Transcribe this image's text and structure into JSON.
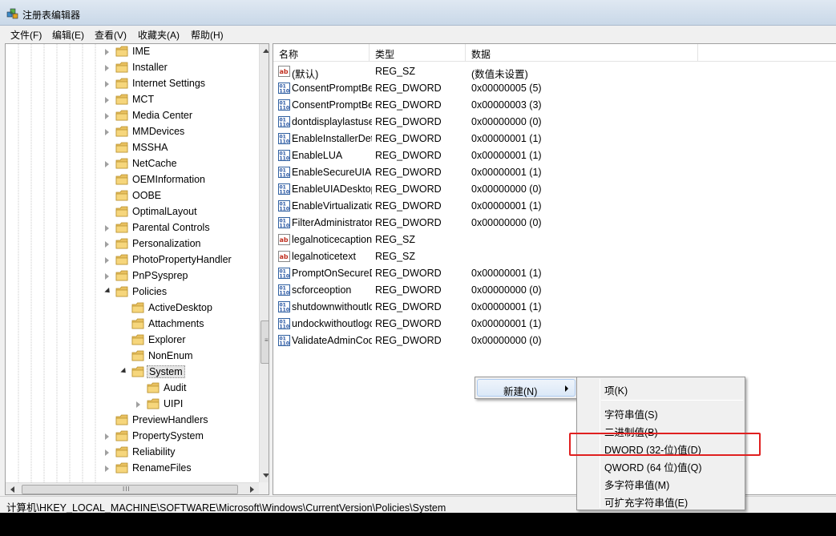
{
  "window": {
    "title": "注册表编辑器"
  },
  "menubar": [
    "文件(F)",
    "编辑(E)",
    "查看(V)",
    "收藏夹(A)",
    "帮助(H)"
  ],
  "tree": {
    "items": [
      {
        "label": "IME",
        "level": 1,
        "state": "collapsed"
      },
      {
        "label": "Installer",
        "level": 1,
        "state": "collapsed"
      },
      {
        "label": "Internet Settings",
        "level": 1,
        "state": "collapsed"
      },
      {
        "label": "MCT",
        "level": 1,
        "state": "collapsed"
      },
      {
        "label": "Media Center",
        "level": 1,
        "state": "collapsed"
      },
      {
        "label": "MMDevices",
        "level": 1,
        "state": "collapsed"
      },
      {
        "label": "MSSHA",
        "level": 1,
        "state": "none"
      },
      {
        "label": "NetCache",
        "level": 1,
        "state": "collapsed"
      },
      {
        "label": "OEMInformation",
        "level": 1,
        "state": "none"
      },
      {
        "label": "OOBE",
        "level": 1,
        "state": "none"
      },
      {
        "label": "OptimalLayout",
        "level": 1,
        "state": "none"
      },
      {
        "label": "Parental Controls",
        "level": 1,
        "state": "collapsed"
      },
      {
        "label": "Personalization",
        "level": 1,
        "state": "collapsed"
      },
      {
        "label": "PhotoPropertyHandler",
        "level": 1,
        "state": "collapsed"
      },
      {
        "label": "PnPSysprep",
        "level": 1,
        "state": "collapsed"
      },
      {
        "label": "Policies",
        "level": 1,
        "state": "expanded"
      },
      {
        "label": "ActiveDesktop",
        "level": 2,
        "state": "none"
      },
      {
        "label": "Attachments",
        "level": 2,
        "state": "none"
      },
      {
        "label": "Explorer",
        "level": 2,
        "state": "none"
      },
      {
        "label": "NonEnum",
        "level": 2,
        "state": "none"
      },
      {
        "label": "System",
        "level": 2,
        "state": "expanded",
        "selected": true
      },
      {
        "label": "Audit",
        "level": 3,
        "state": "none"
      },
      {
        "label": "UIPI",
        "level": 3,
        "state": "collapsed"
      },
      {
        "label": "PreviewHandlers",
        "level": 1,
        "state": "none"
      },
      {
        "label": "PropertySystem",
        "level": 1,
        "state": "collapsed"
      },
      {
        "label": "Reliability",
        "level": 1,
        "state": "collapsed"
      },
      {
        "label": "RenameFiles",
        "level": 1,
        "state": "collapsed"
      }
    ]
  },
  "list": {
    "headers": {
      "name": "名称",
      "type": "类型",
      "data": "数据"
    },
    "rows": [
      {
        "icon": "string",
        "name": "(默认)",
        "type": "REG_SZ",
        "data": "(数值未设置)"
      },
      {
        "icon": "binary",
        "name": "ConsentPromptBehaviorAdmin",
        "type": "REG_DWORD",
        "data": "0x00000005 (5)"
      },
      {
        "icon": "binary",
        "name": "ConsentPromptBehaviorUser",
        "type": "REG_DWORD",
        "data": "0x00000003 (3)"
      },
      {
        "icon": "binary",
        "name": "dontdisplaylastusername",
        "type": "REG_DWORD",
        "data": "0x00000000 (0)"
      },
      {
        "icon": "binary",
        "name": "EnableInstallerDetection",
        "type": "REG_DWORD",
        "data": "0x00000001 (1)"
      },
      {
        "icon": "binary",
        "name": "EnableLUA",
        "type": "REG_DWORD",
        "data": "0x00000001 (1)"
      },
      {
        "icon": "binary",
        "name": "EnableSecureUIAPaths",
        "type": "REG_DWORD",
        "data": "0x00000001 (1)"
      },
      {
        "icon": "binary",
        "name": "EnableUIADesktopToggle",
        "type": "REG_DWORD",
        "data": "0x00000000 (0)"
      },
      {
        "icon": "binary",
        "name": "EnableVirtualization",
        "type": "REG_DWORD",
        "data": "0x00000001 (1)"
      },
      {
        "icon": "binary",
        "name": "FilterAdministratorToken",
        "type": "REG_DWORD",
        "data": "0x00000000 (0)"
      },
      {
        "icon": "string",
        "name": "legalnoticecaption",
        "type": "REG_SZ",
        "data": ""
      },
      {
        "icon": "string",
        "name": "legalnoticetext",
        "type": "REG_SZ",
        "data": ""
      },
      {
        "icon": "binary",
        "name": "PromptOnSecureDesktop",
        "type": "REG_DWORD",
        "data": "0x00000001 (1)"
      },
      {
        "icon": "binary",
        "name": "scforceoption",
        "type": "REG_DWORD",
        "data": "0x00000000 (0)"
      },
      {
        "icon": "binary",
        "name": "shutdownwithoutlogon",
        "type": "REG_DWORD",
        "data": "0x00000001 (1)"
      },
      {
        "icon": "binary",
        "name": "undockwithoutlogon",
        "type": "REG_DWORD",
        "data": "0x00000001 (1)"
      },
      {
        "icon": "binary",
        "name": "ValidateAdminCodeSignatures",
        "type": "REG_DWORD",
        "data": "0x00000000 (0)"
      }
    ]
  },
  "context_menu": {
    "new_label": "新建(N)",
    "submenu": {
      "key": "项(K)",
      "string": "字符串值(S)",
      "binary": "二进制值(B)",
      "dword": "DWORD (32-位)值(D)",
      "qword": "QWORD (64 位)值(Q)",
      "multi_string": "多字符串值(M)",
      "expand_string": "可扩充字符串值(E)"
    }
  },
  "status": {
    "path": "计算机\\HKEY_LOCAL_MACHINE\\SOFTWARE\\Microsoft\\Windows\\CurrentVersion\\Policies\\System"
  },
  "colors": {
    "highlight_box": "#e02020",
    "menu_hover": "#dbe8f7"
  }
}
